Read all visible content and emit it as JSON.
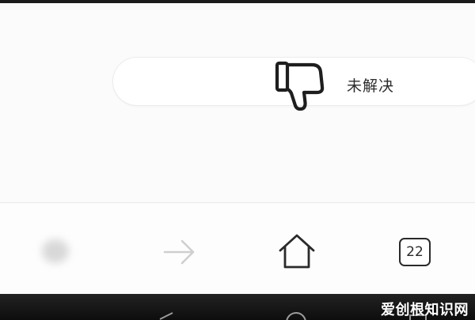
{
  "feedback": {
    "unresolved_label": "未解决",
    "unresolved_icon": "thumbs-down-icon"
  },
  "toolbar": {
    "back_icon": "back-arrow-icon",
    "forward_icon": "forward-arrow-icon",
    "home_icon": "home-icon",
    "tabs_icon": "tabs-icon",
    "tabs_count": "22"
  },
  "system_nav": {
    "back_icon": "triangle-back-icon",
    "home_icon": "circle-home-icon",
    "recent_icon": "square-recent-icon"
  },
  "watermark": {
    "text": "爱创根知识网"
  },
  "colors": {
    "icon": "#2a2a2a",
    "icon_disabled": "#cfcfcf",
    "nav_bar": "#141414"
  }
}
